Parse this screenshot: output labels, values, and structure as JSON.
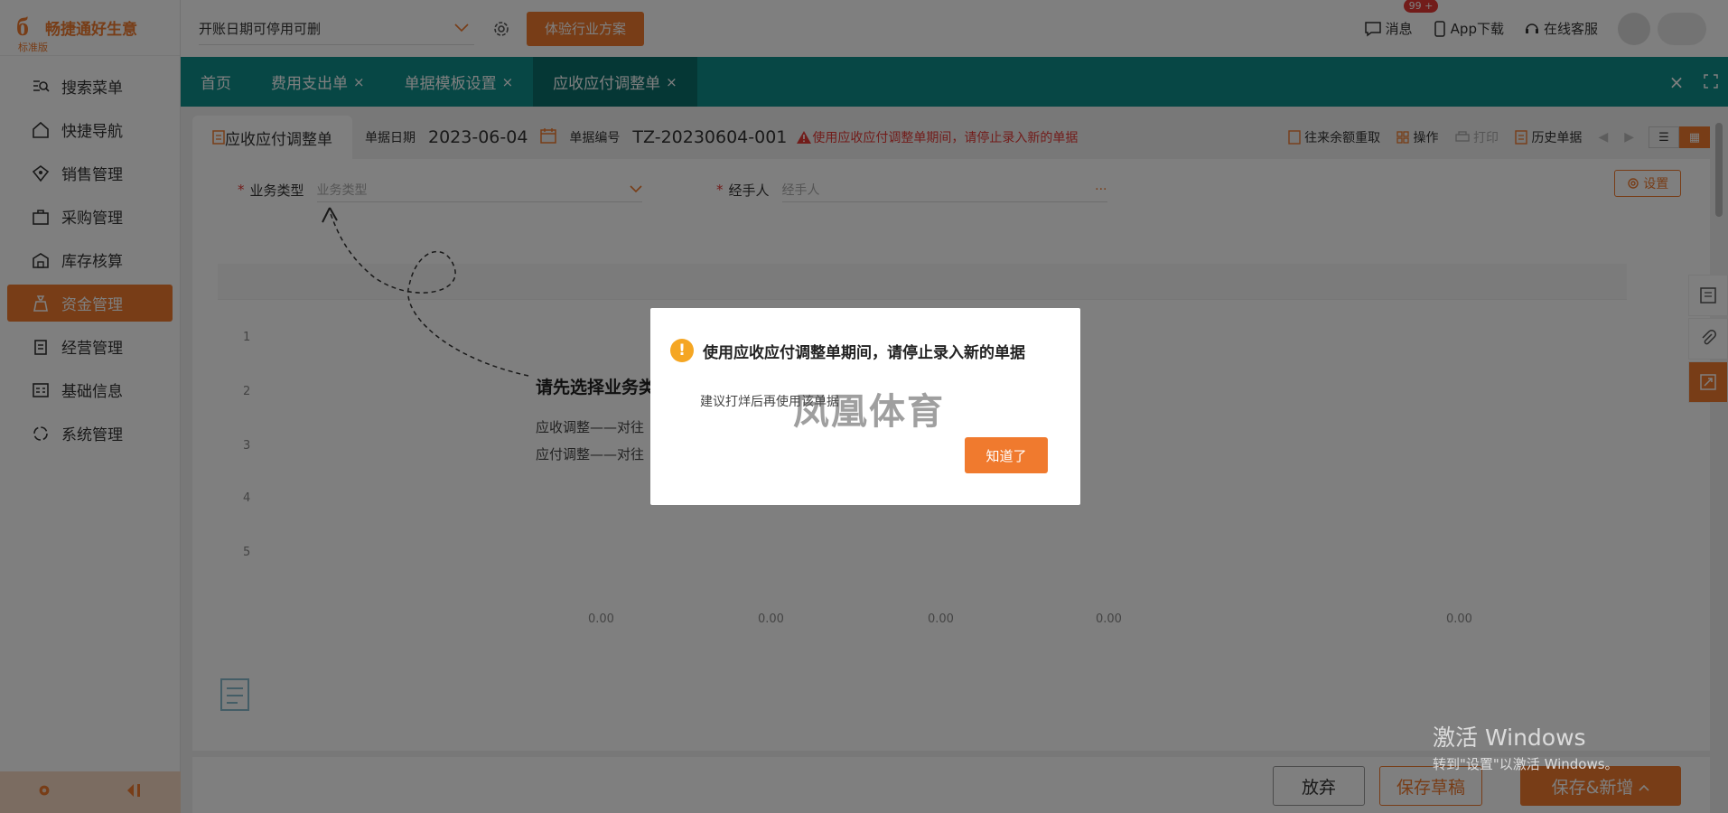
{
  "brand": {
    "name": "畅捷通好生意",
    "edition": "标准版"
  },
  "sidebar": {
    "items": [
      {
        "label": "搜索菜单",
        "icon": "search-menu-icon"
      },
      {
        "label": "快捷导航",
        "icon": "home-icon"
      },
      {
        "label": "销售管理",
        "icon": "sales-icon"
      },
      {
        "label": "采购管理",
        "icon": "purchase-icon"
      },
      {
        "label": "库存核算",
        "icon": "warehouse-icon"
      },
      {
        "label": "资金管理",
        "icon": "money-bag-icon",
        "active": true
      },
      {
        "label": "经营管理",
        "icon": "clipboard-icon"
      },
      {
        "label": "基础信息",
        "icon": "id-card-icon"
      },
      {
        "label": "系统管理",
        "icon": "system-icon"
      }
    ]
  },
  "topbar": {
    "period_select": "开账日期可停用可删",
    "trial_button": "体验行业方案",
    "messages_label": "消息",
    "messages_badge": "99 +",
    "app_download": "App下载",
    "online_service": "在线客服"
  },
  "tabs": [
    {
      "label": "首页",
      "closable": false
    },
    {
      "label": "费用支出单",
      "closable": true
    },
    {
      "label": "单据模板设置",
      "closable": true
    },
    {
      "label": "应收应付调整单",
      "closable": true,
      "active": true
    }
  ],
  "document": {
    "tab_title": "应收应付调整单",
    "date_label": "单据日期",
    "date_value": "2023-06-04",
    "number_label": "单据编号",
    "number_value": "TZ-20230604-001",
    "warning": "使用应收应付调整单期间，请停止录入新的单据",
    "actions": {
      "rebalance": "往来余额重取",
      "operate": "操作",
      "print": "打印",
      "history": "历史单据"
    }
  },
  "form": {
    "business_type_label": "业务类型",
    "business_type_placeholder": "业务类型",
    "handler_label": "经手人",
    "handler_placeholder": "经手人",
    "settings_button": "设置"
  },
  "hint": {
    "title": "请先选择业务类型",
    "line1": "应收调整——对往",
    "line2": "应付调整——对往"
  },
  "table": {
    "row_numbers": [
      "1",
      "2",
      "3",
      "4",
      "5"
    ],
    "totals": [
      "0.00",
      "0.00",
      "0.00",
      "0.00",
      "0.00"
    ]
  },
  "bottom": {
    "discard": "放弃",
    "save_draft": "保存草稿",
    "save_new": "保存&新增"
  },
  "dialog": {
    "title": "使用应收应付调整单期间，请停止录入新的单据",
    "body": "建议打烊后再使用该单据",
    "ok_button": "知道了",
    "watermark": "凤凰体育"
  },
  "windows": {
    "activate_title": "激活 Windows",
    "activate_sub": "转到\"设置\"以激活 Windows。"
  },
  "colors": {
    "accent": "#f07a2e",
    "tabbar": "#0f8e8a",
    "warning": "#e53935"
  }
}
